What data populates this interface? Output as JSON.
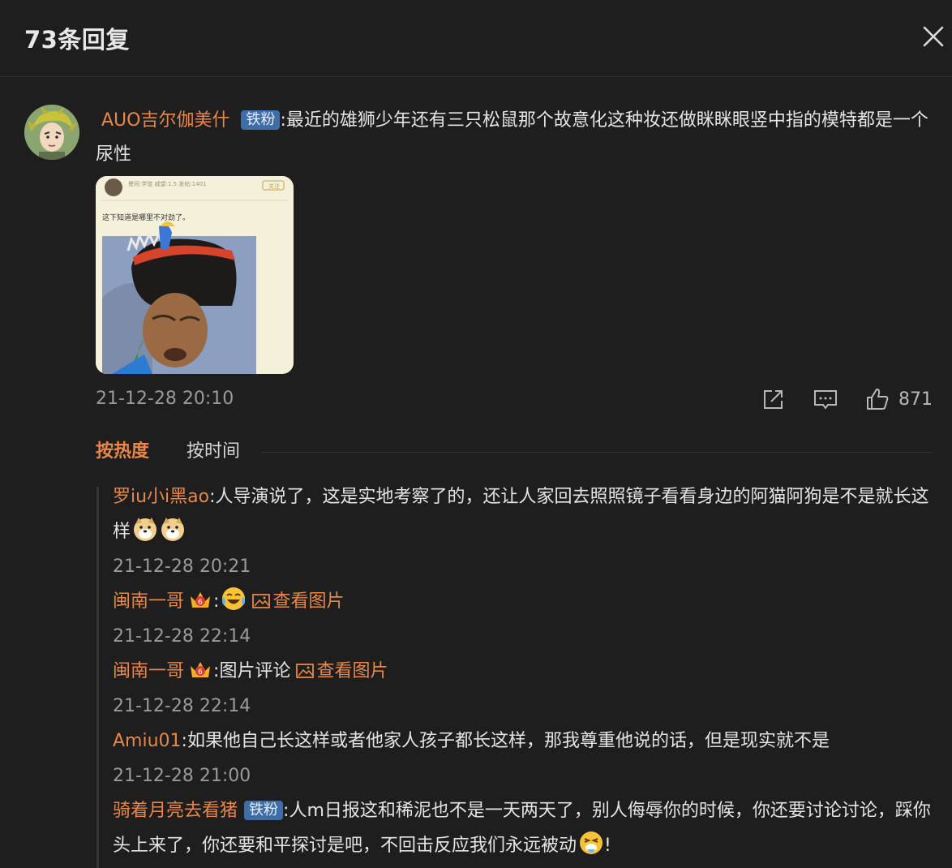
{
  "header": {
    "title": "73条回复"
  },
  "main_comment": {
    "username": "AUO吉尔伽美什",
    "badge": "铁粉",
    "text": "最近的雄狮少年还有三只松鼠那个故意化这种妆还做眯眯眼竖中指的模特都是一个尿性",
    "image_caption": "这下知道是哪里不对劲了。",
    "image_header_text": "曼同:学徒 威望:1.5 发帖:1401",
    "image_header_tag": "关注",
    "timestamp": "21-12-28 20:10",
    "like_count": "871"
  },
  "sort": {
    "hot": "按热度",
    "time": "按时间"
  },
  "replies": [
    {
      "username": "罗iu小i黑ao",
      "text": "人导演说了，这是实地考察了的，还让人家回去照照镜子看看身边的阿猫阿狗是不是就长这样",
      "emojis": [
        "doge",
        "doge"
      ],
      "timestamp": "21-12-28 20:21"
    },
    {
      "username": "闽南一哥",
      "crown": true,
      "text": "",
      "emojis": [
        "laugh-cry"
      ],
      "view_image": "查看图片",
      "timestamp": "21-12-28 22:14"
    },
    {
      "username": "闽南一哥",
      "crown": true,
      "text": "图片评论",
      "view_image": "查看图片",
      "timestamp": "21-12-28 22:14"
    },
    {
      "username": "Amiu01",
      "text": "如果他自己长这样或者他家人孩子都长这样，那我尊重他说的话，但是现实就不是",
      "timestamp": "21-12-28 21:00"
    },
    {
      "username": "骑着月亮去看猪",
      "badge": "铁粉",
      "text": "人m日报这和稀泥也不是一天两天了，别人侮辱你的时候，你还要讨论讨论，踩你头上来了，你还要和平探讨是吧，不回击反应我们永远被动",
      "emojis": [
        "vomit"
      ],
      "text_after": "!"
    }
  ],
  "colors": {
    "accent": "#e8874a",
    "badge": "#3f6ea6",
    "background": "#1e1e1f"
  }
}
